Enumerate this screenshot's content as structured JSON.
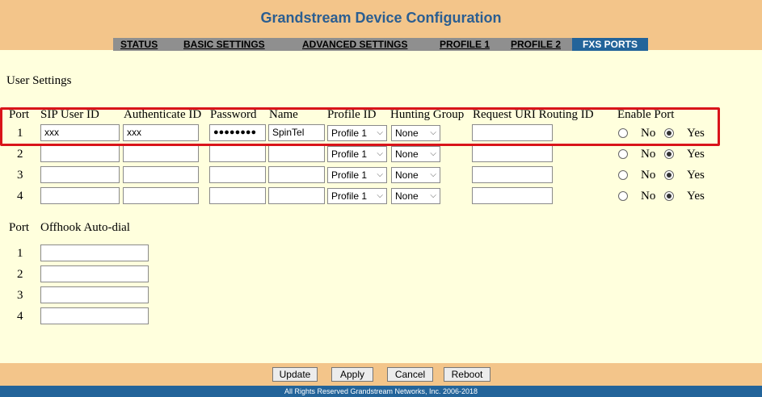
{
  "header": {
    "title": "Grandstream Device Configuration"
  },
  "nav": {
    "status": "STATUS",
    "basic": "BASIC SETTINGS",
    "advanced": "ADVANCED SETTINGS",
    "profile1": "PROFILE 1",
    "profile2": "PROFILE 2",
    "fxs": "FXS PORTS"
  },
  "section": {
    "title": "User Settings"
  },
  "columns": {
    "port": "Port",
    "sip_user_id": "SIP User ID",
    "auth_id": "Authenticate ID",
    "password": "Password",
    "name": "Name",
    "profile_id": "Profile ID",
    "hunting_group": "Hunting Group",
    "request_uri": "Request URI Routing ID",
    "enable_port": "Enable Port"
  },
  "radio_labels": {
    "no": "No",
    "yes": "Yes"
  },
  "rows": [
    {
      "port": "1",
      "sip_user_id": "xxx",
      "auth_id": "xxx",
      "password": "●●●●●●●●",
      "name": "SpinTel",
      "profile": "Profile 1",
      "hunting": "None",
      "request_uri": "",
      "enabled": "Yes"
    },
    {
      "port": "2",
      "sip_user_id": "",
      "auth_id": "",
      "password": "",
      "name": "",
      "profile": "Profile 1",
      "hunting": "None",
      "request_uri": "",
      "enabled": "Yes"
    },
    {
      "port": "3",
      "sip_user_id": "",
      "auth_id": "",
      "password": "",
      "name": "",
      "profile": "Profile 1",
      "hunting": "None",
      "request_uri": "",
      "enabled": "Yes"
    },
    {
      "port": "4",
      "sip_user_id": "",
      "auth_id": "",
      "password": "",
      "name": "",
      "profile": "Profile 1",
      "hunting": "None",
      "request_uri": "",
      "enabled": "Yes"
    }
  ],
  "offhook": {
    "port_label": "Port",
    "label": "Offhook Auto-dial",
    "rows": [
      {
        "port": "1",
        "value": ""
      },
      {
        "port": "2",
        "value": ""
      },
      {
        "port": "3",
        "value": ""
      },
      {
        "port": "4",
        "value": ""
      }
    ]
  },
  "buttons": {
    "update": "Update",
    "apply": "Apply",
    "cancel": "Cancel",
    "reboot": "Reboot"
  },
  "footer": {
    "copyright": "All Rights Reserved Grandstream Networks, Inc. 2006-2018"
  },
  "colors": {
    "header_bg": "#F3C58A",
    "title": "#2B5E91",
    "active_tab": "#23649A",
    "page_bg": "#FFFFDD",
    "highlight": "#D9141A"
  }
}
